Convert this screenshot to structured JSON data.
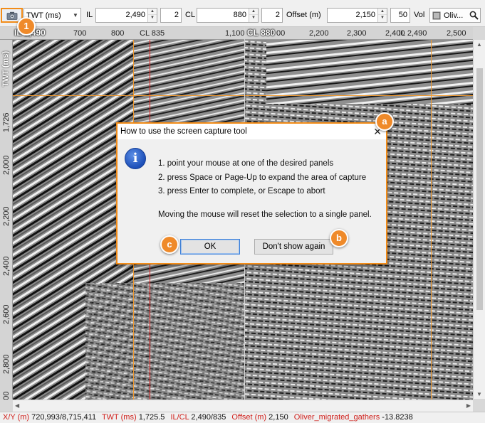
{
  "toolbar": {
    "domain_select": "TWT (ms)",
    "il_label": "IL",
    "il_value": "2,490",
    "il_step": "2",
    "cl_label": "CL",
    "cl_value": "880",
    "cl_step": "2",
    "offset_label": "Offset (m)",
    "offset_value": "2,150",
    "offset_step": "50",
    "vol_label": "Vol",
    "vol_value": "Oliv..."
  },
  "panels": {
    "left": {
      "tag": "IL 2,490",
      "x_ticks": [
        "700",
        "800",
        "CL 835",
        "1,100"
      ],
      "y_axis_label": "TWT (ms)",
      "y_ticks": [
        "1,726",
        "2,000",
        "2,200",
        "2,400",
        "2,600",
        "2,800",
        "3,000"
      ]
    },
    "right": {
      "tag": "CL 880",
      "x_ticks": [
        "00",
        "2,200",
        "2,300",
        "2,400",
        "IL 2,490",
        "2,500"
      ]
    }
  },
  "status": {
    "xy_key": "X/Y (m)",
    "xy_val": "720,993/8,715,411",
    "twt_key": "TWT (ms)",
    "twt_val": "1,725.5",
    "ilcl_key": "IL/CL",
    "ilcl_val": "2,490/835",
    "offset_key": "Offset (m)",
    "offset_val": "2,150",
    "vol_key": "Oliver_migrated_gathers",
    "vol_val": "-13.8238"
  },
  "dialog": {
    "title": "How to use the screen capture tool",
    "lines": [
      "1. point your mouse at one of the desired panels",
      "2. press Space or Page-Up to expand the area of capture",
      "3. press Enter to complete, or Escape to abort",
      "Moving the mouse will reset the selection to a single panel."
    ],
    "ok_label": "OK",
    "dont_show_label": "Don't show again"
  },
  "callouts": {
    "one": "1",
    "a": "a",
    "b": "b",
    "c": "c"
  },
  "colors": {
    "accent": "#ef8a2a",
    "status_key": "#d0201c"
  }
}
